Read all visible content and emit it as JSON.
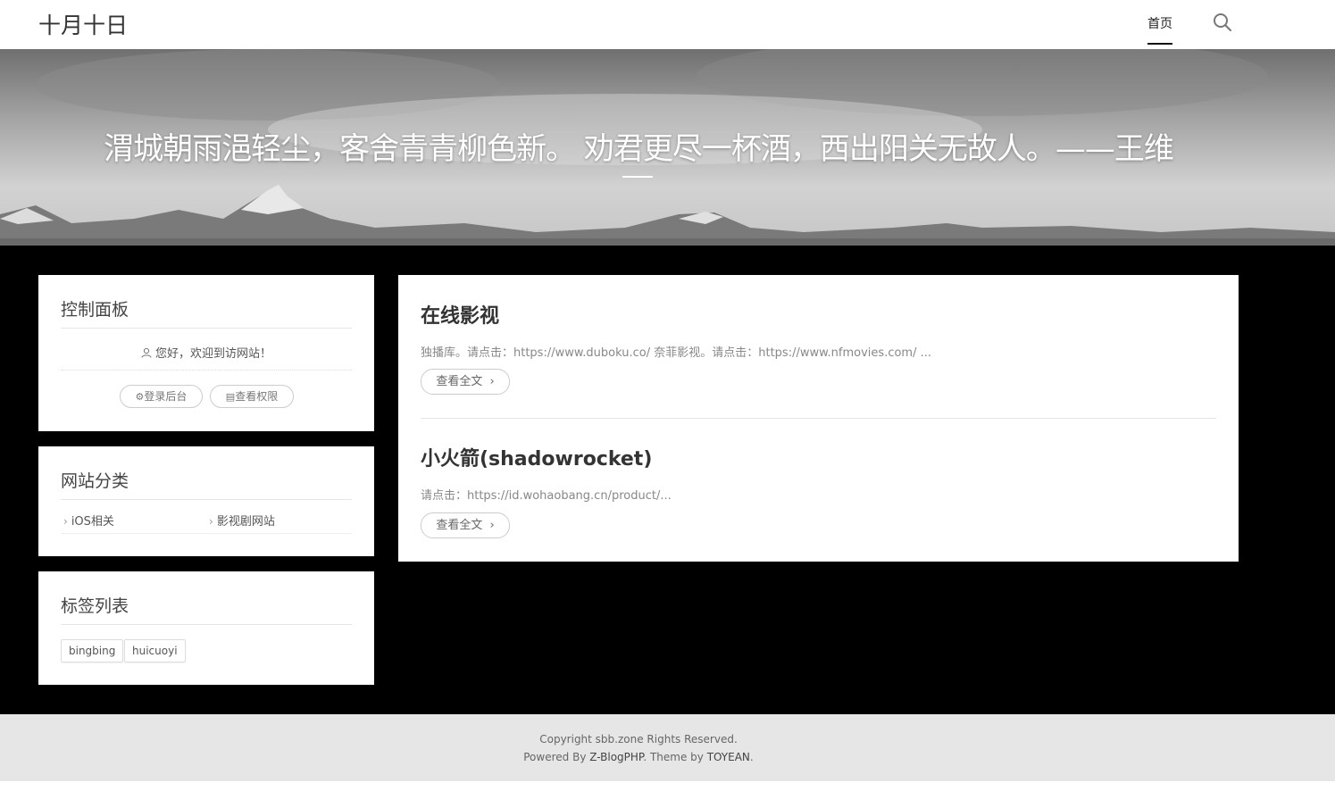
{
  "header": {
    "site_title": "十月十日",
    "nav": [
      {
        "label": "首页"
      }
    ],
    "search_icon": "search-icon"
  },
  "banner": {
    "quote": "渭城朝雨浥轻尘，客舍青青柳色新。 劝君更尽一杯酒，西出阳关无故人。——王维"
  },
  "sidebar": {
    "control_panel": {
      "title": "控制面板",
      "welcome": "您好，欢迎到访网站！",
      "login_button": "登录后台",
      "permissions_button": "查看权限"
    },
    "categories": {
      "title": "网站分类",
      "items": [
        {
          "label": "iOS相关"
        },
        {
          "label": "影视剧网站"
        }
      ]
    },
    "tags": {
      "title": "标签列表",
      "items": [
        {
          "label": "bingbing"
        },
        {
          "label": "huicuoyi"
        }
      ]
    }
  },
  "posts": [
    {
      "title": "在线影视",
      "excerpt": "独播库。请点击：https://www.duboku.co/ 奈菲影视。请点击：https://www.nfmovies.com/ ...",
      "read_more": "查看全文"
    },
    {
      "title": "小火箭(shadowrocket)",
      "excerpt": "请点击：https://id.wohaobang.cn/product/...",
      "read_more": "查看全文"
    }
  ],
  "footer": {
    "copyright": "Copyright sbb.zone Rights Reserved.",
    "powered_prefix": "Powered By ",
    "powered_link": "Z-BlogPHP",
    "theme_prefix": ". Theme by ",
    "theme_link": "TOYEAN",
    "theme_suffix": "."
  },
  "colors": {
    "main_background": "#000000",
    "footer_background": "#e6e6e6",
    "card_background": "#ffffff"
  }
}
